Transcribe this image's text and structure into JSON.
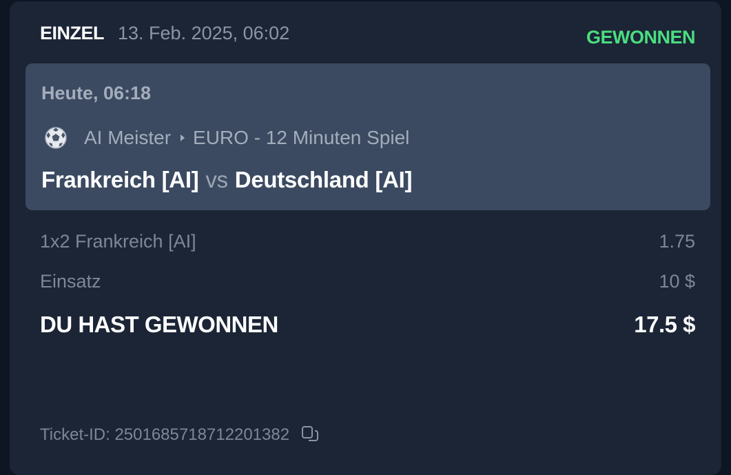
{
  "header": {
    "bet_type": "EINZEL",
    "placed_at": "13. Feb. 2025, 06:02",
    "status": "GEWONNEN",
    "status_color": "#4ade80"
  },
  "event": {
    "time": "Heute, 06:18",
    "sport_icon": "soccer-ball-icon",
    "league": "AI Meister",
    "competition": "EURO - 12 Minuten Spiel",
    "home_team": "Frankreich [AI]",
    "vs": "vs",
    "away_team": "Deutschland [AI]"
  },
  "selection": {
    "market": "1x2 Frankreich [AI]",
    "odds": "1.75"
  },
  "stake": {
    "label": "Einsatz",
    "amount": "10 $"
  },
  "result": {
    "label": "DU HAST GEWONNEN",
    "amount": "17.5 $"
  },
  "ticket": {
    "label": "Ticket-ID: 2501685718712201382",
    "copy_icon": "copy-icon"
  }
}
